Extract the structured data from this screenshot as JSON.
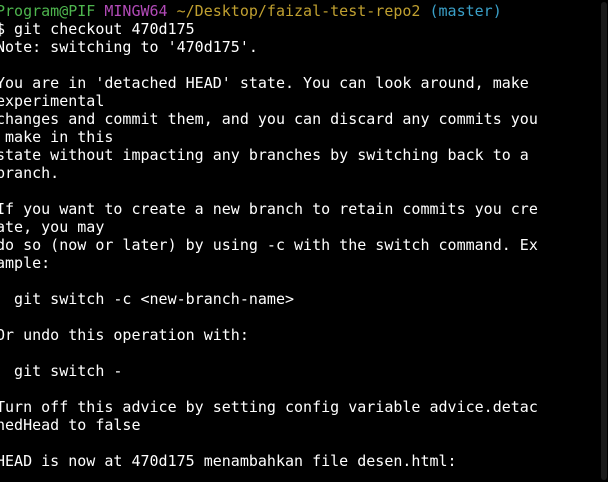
{
  "colors": {
    "background": "#000000",
    "text": "#ffffff",
    "prompt_user": "#4eb54e",
    "prompt_env": "#b24ab7",
    "prompt_path": "#c0a030",
    "prompt_branch": "#3aa0c8"
  },
  "prompt": {
    "user_host": "Program@PIF",
    "env": "MINGW64",
    "path": "~/Desktop/faizal-test-repo2",
    "branch": "(master)"
  },
  "command": "$ git checkout 470d175",
  "output": [
    "Note: switching to '470d175'.",
    "",
    "You are in 'detached HEAD' state. You can look around, make",
    "experimental",
    "changes and commit them, and you can discard any commits you",
    " make in this",
    "state without impacting any branches by switching back to a",
    "branch.",
    "",
    "If you want to create a new branch to retain commits you cre",
    "ate, you may",
    "do so (now or later) by using -c with the switch command. Ex",
    "ample:",
    "",
    "  git switch -c <new-branch-name>",
    "",
    "Or undo this operation with:",
    "",
    "  git switch -",
    "",
    "Turn off this advice by setting config variable advice.detac",
    "hedHead to false",
    "",
    "HEAD is now at 470d175 menambahkan file desen.html:"
  ]
}
